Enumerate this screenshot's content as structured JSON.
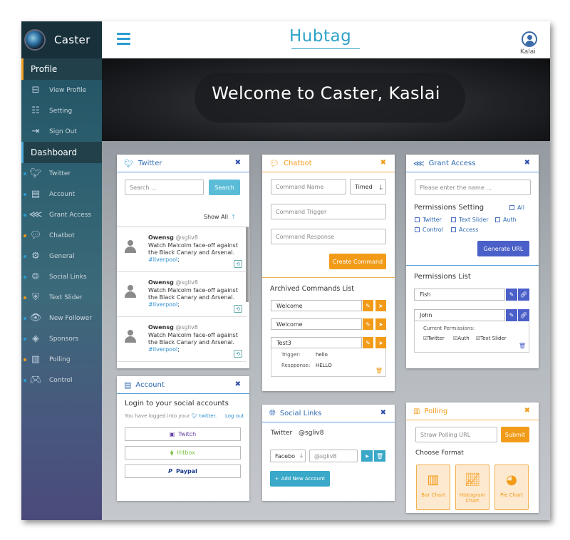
{
  "brand": {
    "name": "Caster"
  },
  "sidebar": {
    "profile_section": "Profile",
    "profile_items": [
      {
        "label": "View Profile",
        "icon": "inbox-icon"
      },
      {
        "label": "Setting",
        "icon": "sliders-icon"
      },
      {
        "label": "Sign Out",
        "icon": "sign-out-icon"
      }
    ],
    "dashboard_section": "Dashboard",
    "dashboard_items": [
      {
        "label": "Twitter",
        "icon": "twitter-icon",
        "dot": "#2a9bd0"
      },
      {
        "label": "Account",
        "icon": "account-icon",
        "dot": "#2a9bd0"
      },
      {
        "label": "Grant Access",
        "icon": "share-icon",
        "dot": "#2a9bd0"
      },
      {
        "label": "Chatbot",
        "icon": "chat-icon",
        "dot": "#f29b18"
      },
      {
        "label": "General",
        "icon": "gear-icon",
        "dot": "#2a9bd0"
      },
      {
        "label": "Social Links",
        "icon": "globe-icon",
        "dot": "#2a9bd0"
      },
      {
        "label": "Text Slider",
        "icon": "slider-icon",
        "dot": "#f29b18"
      },
      {
        "label": "New Follower",
        "icon": "eye-icon",
        "dot": "#2a9bd0"
      },
      {
        "label": "Sponsors",
        "icon": "diamond-icon",
        "dot": "#2a9bd0"
      },
      {
        "label": "Polling",
        "icon": "bar-chart-icon",
        "dot": "#f29b18"
      },
      {
        "label": "Control",
        "icon": "gamepad-icon",
        "dot": "#2a9bd0"
      }
    ]
  },
  "header": {
    "title": "Hubtag",
    "user": "Kalai"
  },
  "hero": {
    "title": "Welcome to Caster, Kaslai"
  },
  "twitter": {
    "title": "Twitter",
    "search_placeholder": "Search ...",
    "search_button": "Search",
    "show_all": "Show All",
    "tweets": [
      {
        "user": "Owensg",
        "handle": "@sgliv8",
        "text": "Watch Malcolm face-off against the Black Canary and Arsenal.",
        "tag": "#liverpool",
        "end": ";"
      },
      {
        "user": "Owensg",
        "handle": "@sgliv8",
        "text": "Watch Malcolm face-off against the Black Canary and Arsenal.",
        "tag": "#liverpool",
        "end": ";"
      },
      {
        "user": "Owensg",
        "handle": "@sgliv8",
        "text": "Watch Malcolm face-off against the Black Canary and Arsenal.",
        "tag": "#liverpool",
        "end": ";"
      }
    ]
  },
  "account": {
    "title": "Account",
    "heading": "Login to your social accounts",
    "logged_in_prefix": "You have logged into your",
    "logged_in_service": "twitter.",
    "logout": "Log out",
    "buttons": [
      {
        "label": "Twitch",
        "color": "#6441a4"
      },
      {
        "label": "Hitbox",
        "color": "#7ac143"
      },
      {
        "label": "Paypal",
        "color": "#1a3a8a"
      }
    ]
  },
  "chatbot": {
    "title": "Chatbot",
    "command_name_placeholder": "Command Name",
    "timed_select": "Timed",
    "command_trigger_placeholder": "Command Trigger",
    "command_response_placeholder": "Command Response",
    "create_button": "Create Command",
    "archived_title": "Archived Commands List",
    "commands": [
      "Welcome",
      "Welcome",
      "Test3"
    ],
    "trigger_label": "Trigger:",
    "trigger_value": "hello",
    "response_label": "Respponse:",
    "response_value": "HELLO"
  },
  "social_links": {
    "title": "Social Links",
    "platform": "Twitter",
    "handle": "@sgliv8",
    "select_value": "Facebo",
    "input_placeholder": "@sgliv8",
    "add_button": "Add New Account"
  },
  "grant_access": {
    "title": "Grant Access",
    "name_placeholder": "Please enter the name ...",
    "permissions_setting": "Permissions Setting",
    "all_label": "All",
    "checkboxes": [
      "Twitter",
      "Text Slider",
      "Auth",
      "Control",
      "Access"
    ],
    "generate_button": "Generate URL",
    "permissions_list": "Permissions List",
    "users": [
      "Fish",
      "John"
    ],
    "current_permissions_label": "Current Permissions:",
    "current_permissions": [
      "Twitter",
      "Auth",
      "Text Slider"
    ]
  },
  "polling": {
    "title": "Polling",
    "url_placeholder": "Straw Polling URL",
    "submit": "Submit",
    "choose_format": "Choose Format",
    "formats": [
      {
        "label": "Bar Chart",
        "icon": "bar-chart-icon"
      },
      {
        "label": "Histogram Chart",
        "icon": "trend-icon"
      },
      {
        "label": "Pie Chart",
        "icon": "pie-chart-icon"
      }
    ]
  },
  "colors": {
    "blue": "#2f6ab0",
    "orange": "#f29b18",
    "teal": "#3aa8c8",
    "indigo": "#4a5fc8"
  }
}
